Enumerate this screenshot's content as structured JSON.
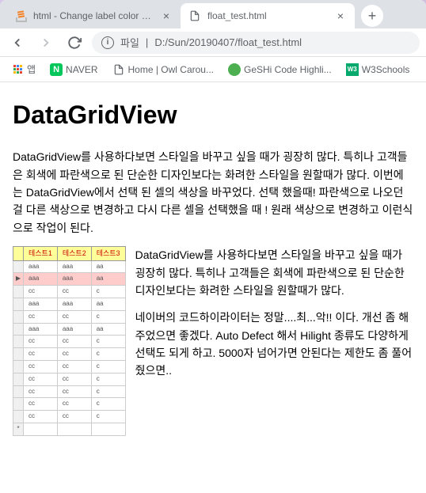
{
  "tabs": [
    {
      "title": "html - Change label color from",
      "active": false
    },
    {
      "title": "float_test.html",
      "active": true
    }
  ],
  "address": {
    "label": "파일",
    "path": "D:/Sun/20190407/float_test.html"
  },
  "bookmarks": [
    {
      "label": "앱",
      "icon": "apps"
    },
    {
      "label": "NAVER",
      "icon": "naver"
    },
    {
      "label": "Home | Owl Carou...",
      "icon": "file"
    },
    {
      "label": "GeSHi Code Highli...",
      "icon": "geshi"
    },
    {
      "label": "W3Schools",
      "icon": "w3"
    }
  ],
  "page": {
    "heading": "DataGridView",
    "para1": "DataGridView를 사용하다보면 스타일을 바꾸고 싶을 때가 굉장히 많다. 특히나 고객들은 회색에 파란색으로 된 단순한 디자인보다는 화려한 스타일을 원할때가 많다. 이번에는 DataGridView에서 선택 된 셀의 색상을 바꾸었다. 선택 했을때! 파란색으로 나오던 걸 다른 색상으로 변경하고 다시 다른 셀을 선택했을 때 ! 원래 색상으로 변경하고 이런식으로 작업이 된다.",
    "para2": "DataGridView를 사용하다보면 스타일을 바꾸고 싶을 때가 굉장히 많다. 특히나 고객들은 회색에 파란색으로 된 단순한 디자인보다는 화려한 스타일을 원할때가 많다.",
    "para3": "네이버의 코드하이라이터는 정말....최...악!! 이다. 개선 좀 해주었으면 좋겠다. Auto Defect 해서 Hilight 종류도 다양하게 선택도 되게 하고. 5000자 넘어가면 안된다는 제한도 좀 풀어줬으면..",
    "table": {
      "headers": [
        "테스트1",
        "테스트2",
        "테스트3"
      ],
      "rows": [
        {
          "cells": [
            "aaa",
            "aaa",
            "aa"
          ],
          "selected": false
        },
        {
          "cells": [
            "aaa",
            "aaa",
            "aa"
          ],
          "selected": true
        },
        {
          "cells": [
            "cc",
            "cc",
            "c"
          ],
          "selected": false
        },
        {
          "cells": [
            "aaa",
            "aaa",
            "aa"
          ],
          "selected": false
        },
        {
          "cells": [
            "cc",
            "cc",
            "c"
          ],
          "selected": false
        },
        {
          "cells": [
            "aaa",
            "aaa",
            "aa"
          ],
          "selected": false
        },
        {
          "cells": [
            "cc",
            "cc",
            "c"
          ],
          "selected": false
        },
        {
          "cells": [
            "cc",
            "cc",
            "c"
          ],
          "selected": false
        },
        {
          "cells": [
            "cc",
            "cc",
            "c"
          ],
          "selected": false
        },
        {
          "cells": [
            "cc",
            "cc",
            "c"
          ],
          "selected": false
        },
        {
          "cells": [
            "cc",
            "cc",
            "c"
          ],
          "selected": false
        },
        {
          "cells": [
            "cc",
            "cc",
            "c"
          ],
          "selected": false
        },
        {
          "cells": [
            "cc",
            "cc",
            "c"
          ],
          "selected": false
        }
      ]
    }
  }
}
